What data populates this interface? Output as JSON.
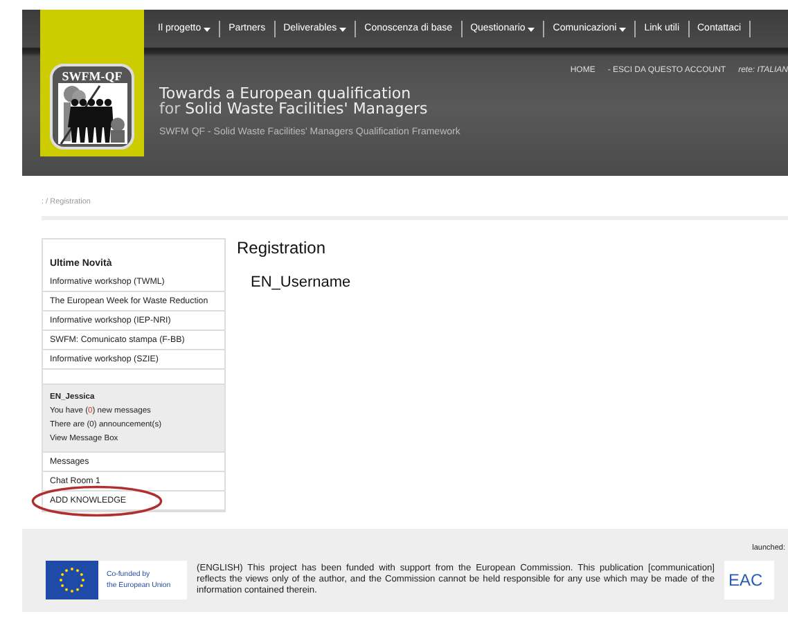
{
  "nav": [
    {
      "label": "Il progetto",
      "has_menu": true
    },
    {
      "label": "Partners",
      "has_menu": false
    },
    {
      "label": "Deliverables",
      "has_menu": true
    },
    {
      "label": "Conoscenza di base",
      "has_menu": false
    },
    {
      "label": "Questionario",
      "has_menu": true
    },
    {
      "label": "Comunicazioni",
      "has_menu": true
    },
    {
      "label": "Link utili",
      "has_menu": false
    },
    {
      "label": "Contattaci",
      "has_menu": false
    }
  ],
  "logo": {
    "text": "SWFM-QF"
  },
  "account_links": [
    "HOME",
    "- ESCI DA QUESTO ACCOUNT"
  ],
  "language": "rete: ITALIAN",
  "site_title": {
    "line1": "Towards a European qualification",
    "line2_prefix": "for",
    "line2": "Solid Waste Facilities' Managers"
  },
  "site_subtitle": "SWFM QF - Solid Waste Facilities' Managers Qualification Framework",
  "breadcrumb": ": / Registration",
  "sidebar": {
    "heading": "Ultime Novità",
    "news": [
      "Informative workshop (TWML)",
      "The European Week for Waste Reduction",
      "Informative workshop (IEP-NRI)",
      "SWFM: Comunicato stampa (F-BB)",
      "Informative workshop (SZIE)"
    ],
    "user": {
      "name": "EN_Jessica",
      "messages_before": "You have (",
      "messages_count": "0",
      "messages_after": ") new messages",
      "announcements": "There are (0) announcement(s)",
      "message_box": "View Message Box"
    },
    "links": [
      {
        "label": "Messages",
        "circled": false
      },
      {
        "label": "Chat Room 1",
        "circled": false
      },
      {
        "label": "ADD KNOWLEDGE",
        "circled": true
      }
    ]
  },
  "main": {
    "title": "Registration",
    "username": "EN_Username"
  },
  "footer": {
    "launched": "launched:",
    "eu_label": [
      "Co-funded by",
      "the European Union"
    ],
    "disclaimer": "(ENGLISH) This project has been funded with support from the European Commission. This publication [communication] reflects the views only of the author, and the Commission cannot be held responsible for any use which may be made of the information contained therein.",
    "partner_logo": "EAC"
  }
}
